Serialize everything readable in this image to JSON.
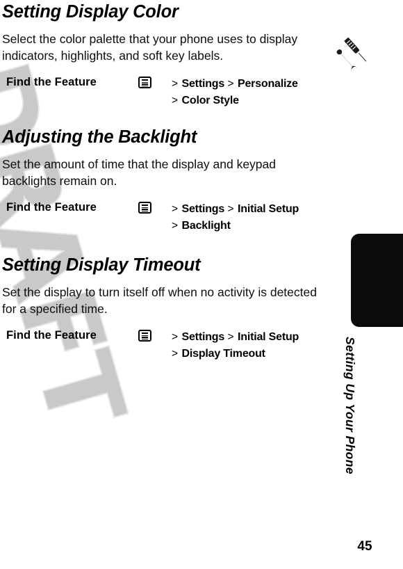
{
  "page": {
    "number": "45",
    "watermark": "DRAFT",
    "watermark_color": "#c9c9c9",
    "background_color": "#ffffff",
    "text_color": "#000000"
  },
  "sidebar": {
    "chapter_title": "Setting Up Your Phone",
    "tab_color": "#0b0b0b",
    "tab_icon": "wrench-screwdriver-icon"
  },
  "sections": [
    {
      "heading": "Setting Display Color",
      "body": "Select the color palette that your phone uses to display indicators, highlights, and soft key labels.",
      "find_the_feature": {
        "label": "Find the Feature",
        "icon": "menu-icon",
        "path_lines": [
          {
            "separator": ">",
            "crumbs": [
              "Settings",
              "Personalize"
            ]
          },
          {
            "separator": ">",
            "crumbs": [
              "Color Style"
            ]
          }
        ]
      }
    },
    {
      "heading": "Adjusting the Backlight",
      "body": "Set the amount of time that the display and keypad backlights remain on.",
      "find_the_feature": {
        "label": "Find the Feature",
        "icon": "menu-icon",
        "path_lines": [
          {
            "separator": ">",
            "crumbs": [
              "Settings",
              "Initial Setup"
            ]
          },
          {
            "separator": ">",
            "crumbs": [
              "Backlight"
            ]
          }
        ]
      }
    },
    {
      "heading": "Setting Display Timeout",
      "body": "Set the display to turn itself off when no activity is detected for a specified time.",
      "find_the_feature": {
        "label": "Find the Feature",
        "icon": "menu-icon",
        "path_lines": [
          {
            "separator": ">",
            "crumbs": [
              "Settings",
              "Initial Setup"
            ]
          },
          {
            "separator": ">",
            "crumbs": [
              "Display Timeout"
            ]
          }
        ]
      }
    }
  ]
}
